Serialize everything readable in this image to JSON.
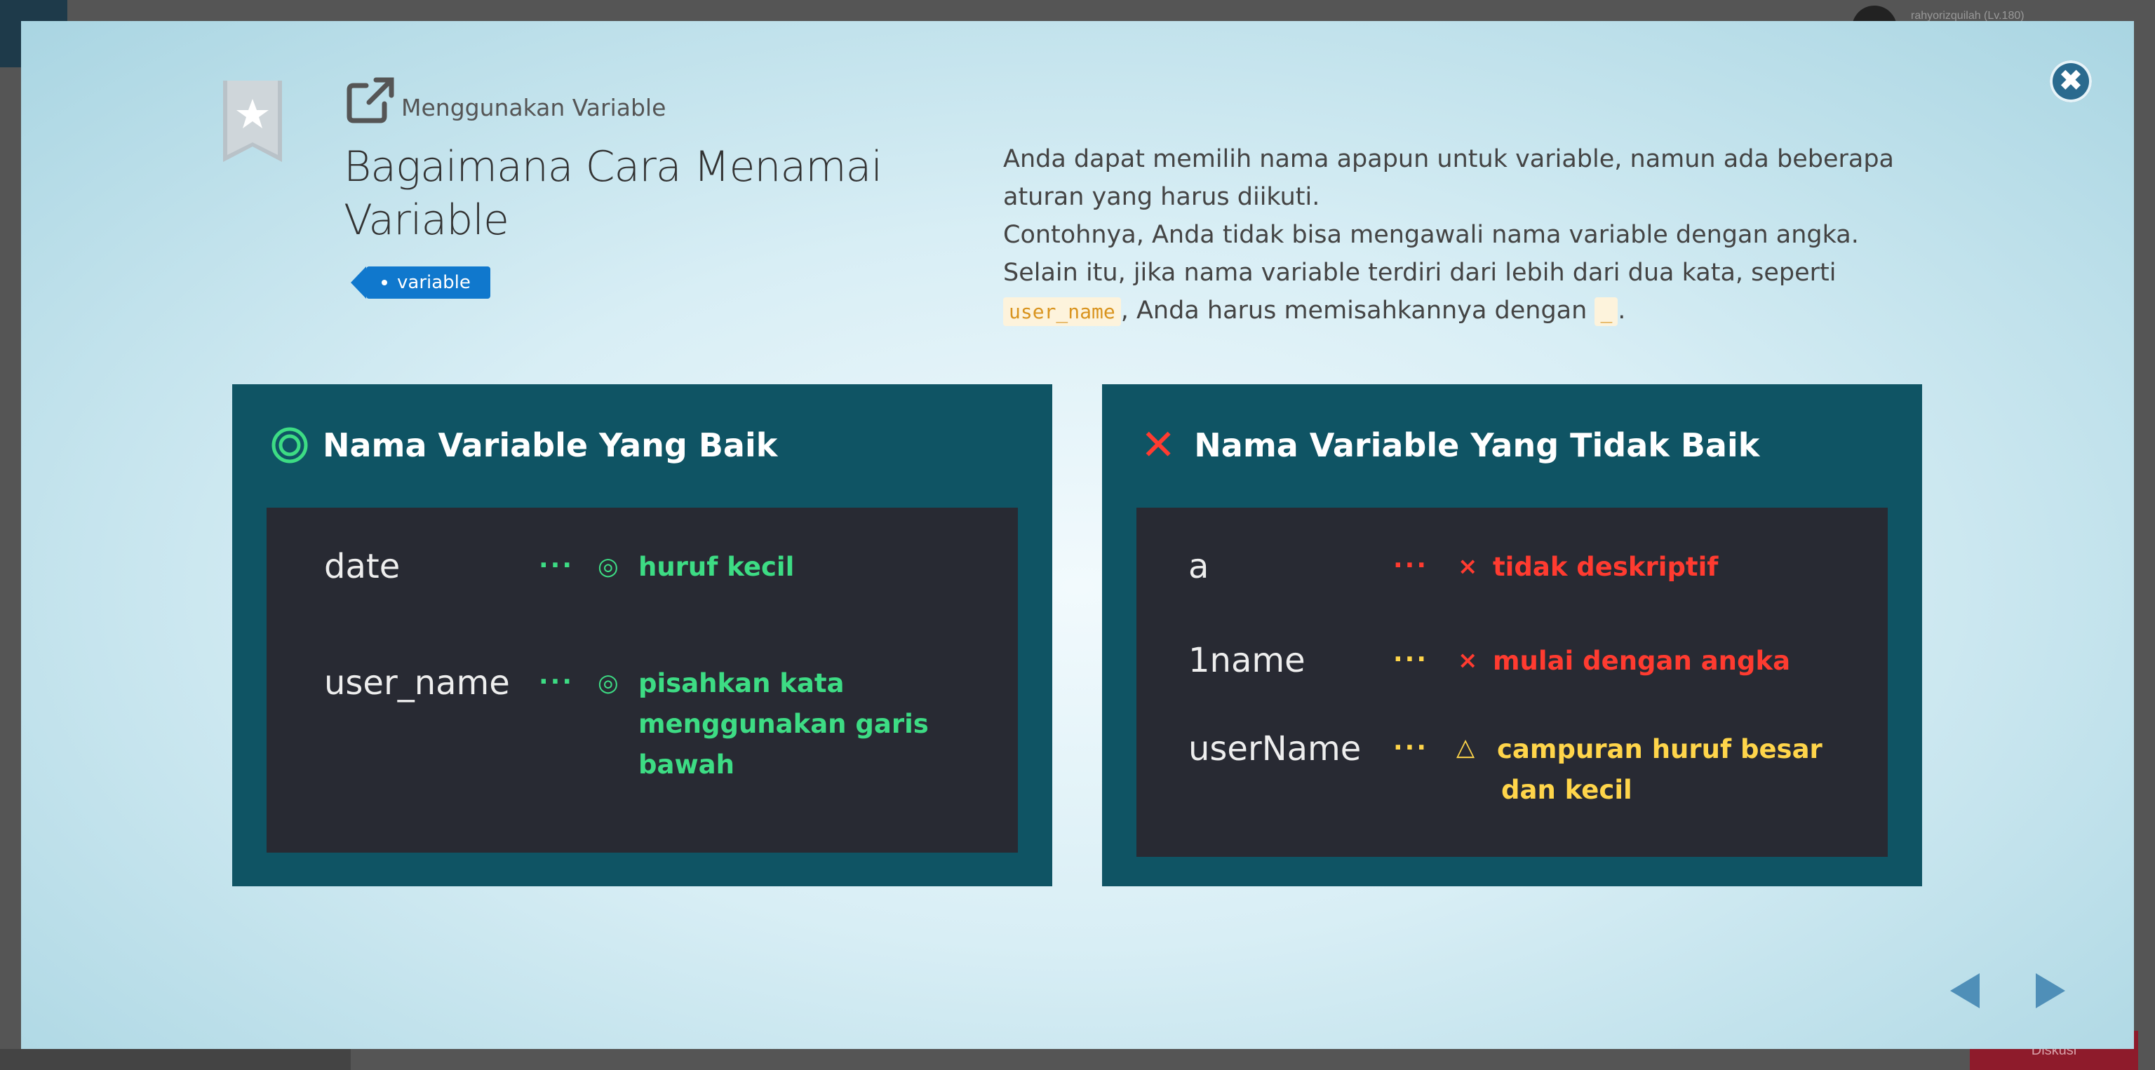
{
  "background": {
    "user_label": "rahyorizquilah (Lv.180)",
    "bottom_button": "Diskusi"
  },
  "modal": {
    "category": "Menggunakan Variable",
    "title": "Bagaimana Cara Menamai Variable",
    "tag": "variable",
    "description": {
      "line1": "Anda dapat memilih nama apapun untuk variable, namun ada beberapa aturan yang harus diikuti.",
      "line2": "Contohnya, Anda tidak bisa mengawali nama variable dengan angka.",
      "line3": "Selain itu, jika nama variable terdiri dari lebih dari dua kata, seperti",
      "code1": "user_name",
      "line4": ", Anda harus memisahkannya dengan",
      "code2": "_",
      "line5": "."
    },
    "good_card": {
      "heading": "Nama Variable Yang Baik",
      "rows": [
        {
          "var": "date",
          "dots": "···",
          "mark": "◎",
          "note1": "huruf kecil",
          "note2": ""
        },
        {
          "var": "user_name",
          "dots": "···",
          "mark": "◎",
          "note1": "pisahkan kata",
          "note2": "menggunakan garis bawah"
        }
      ]
    },
    "bad_card": {
      "heading": "Nama Variable Yang Tidak Baik",
      "heading_mark": "✕",
      "rows": [
        {
          "var": "a",
          "dots": "···",
          "mark": "×",
          "note1": "tidak deskriptif",
          "note2": ""
        },
        {
          "var": "1name",
          "dots": "···",
          "mark": "×",
          "note1": "mulai dengan angka",
          "note2": ""
        },
        {
          "var": "userName",
          "dots": "···",
          "mark": "△",
          "note1": "campuran huruf besar",
          "note2": "dan kecil"
        }
      ]
    },
    "colors": {
      "card_bg": "#0f5464",
      "code_bg": "#282a33",
      "good": "#3ddc84",
      "bad": "#ff3b30",
      "warn": "#ffd54a",
      "tag": "#1078cd"
    }
  }
}
